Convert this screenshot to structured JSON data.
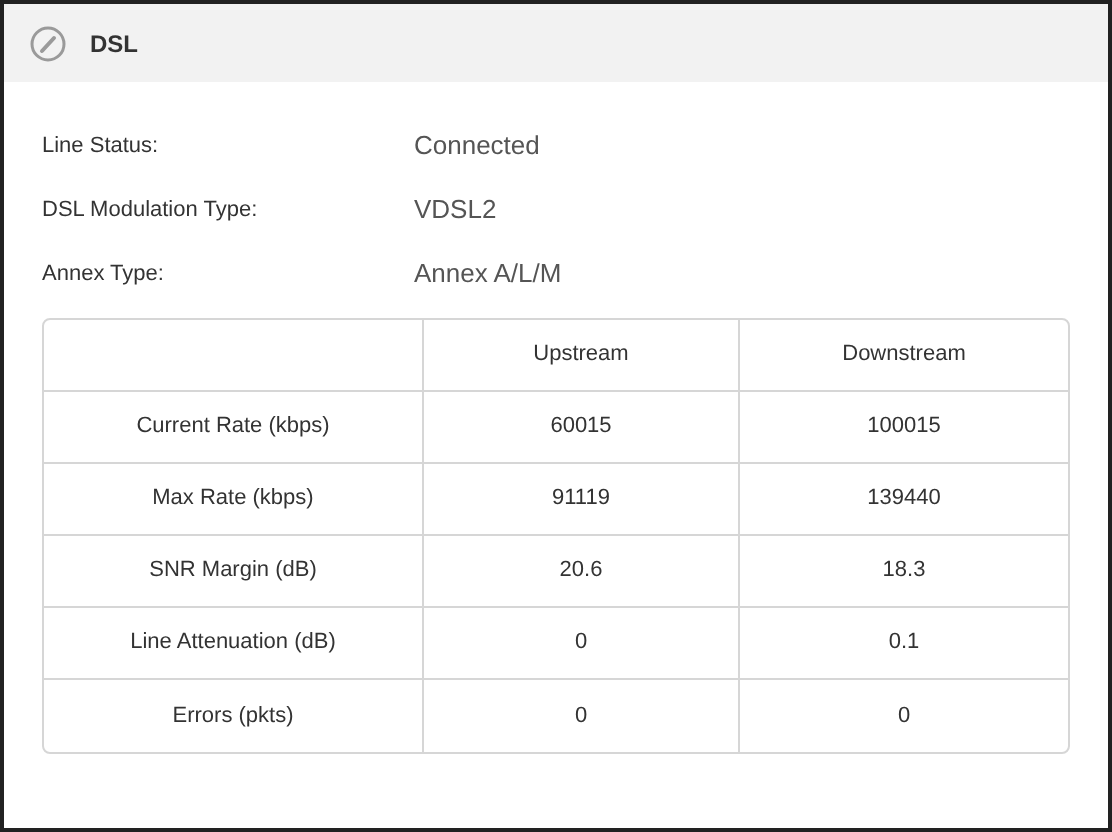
{
  "panel": {
    "title": "DSL"
  },
  "fields": [
    {
      "label": "Line Status:",
      "value": "Connected"
    },
    {
      "label": "DSL Modulation Type:",
      "value": "VDSL2"
    },
    {
      "label": "Annex Type:",
      "value": "Annex A/L/M"
    }
  ],
  "table": {
    "columns": [
      "Upstream",
      "Downstream"
    ],
    "rows": [
      {
        "label": "Current Rate (kbps)",
        "cells": [
          "60015",
          "100015"
        ]
      },
      {
        "label": "Max Rate (kbps)",
        "cells": [
          "91119",
          "139440"
        ]
      },
      {
        "label": "SNR Margin (dB)",
        "cells": [
          "20.6",
          "18.3"
        ]
      },
      {
        "label": "Line Attenuation (dB)",
        "cells": [
          "0",
          "0.1"
        ]
      },
      {
        "label": "Errors (pkts)",
        "cells": [
          "0",
          "0"
        ]
      }
    ]
  }
}
